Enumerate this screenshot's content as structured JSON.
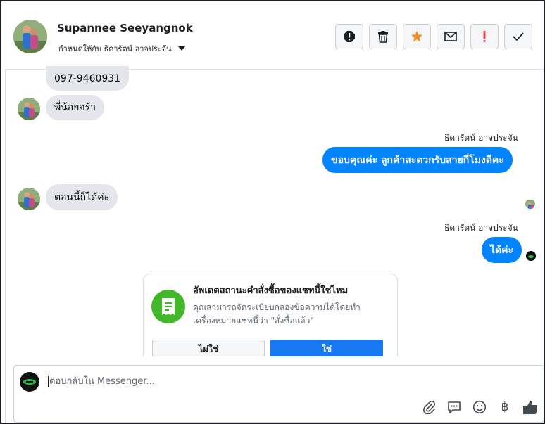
{
  "contact": {
    "name": "Supannee Seeyangnok",
    "assigned_label": "กำหนดให้กับ ธิดารัตน์ อาจประจัน"
  },
  "actions": [
    {
      "name": "spam-icon",
      "color": "#1c1e21"
    },
    {
      "name": "trash-icon",
      "color": "#1c1e21"
    },
    {
      "name": "star-icon",
      "color": "#f28c28"
    },
    {
      "name": "envelope-icon",
      "color": "#1c1e21"
    },
    {
      "name": "exclamation-icon",
      "color": "#fa383e"
    },
    {
      "name": "checkmark-icon",
      "color": "#1c1e21"
    }
  ],
  "messages": [
    {
      "from": "contact",
      "text": "097-9460931"
    },
    {
      "from": "contact",
      "text": "พี่น้อยจร้า"
    },
    {
      "from": "agent",
      "sender": "ธิดารัตน์ อาจประจัน",
      "text": "ขอบคุณค่ะ ลูกค้าสะดวกรับสายกี่โมงดีคะ"
    },
    {
      "from": "contact",
      "text": "ตอนนี้ก็ได้ค่ะ"
    },
    {
      "from": "agent",
      "sender": "ธิดารัตน์ อาจประจัน",
      "text": "ได้ค่ะ"
    }
  ],
  "order_card": {
    "title": "อัพเดตสถานะคำสั่งซื้อของแชทนี้ใช่ไหม",
    "description": "คุณสามารถจัดระเบียบกล่องข้อความได้โดยทำเครื่องหมายแชทนี้ว่า \"สั่งซื้อแล้ว\"",
    "no_label": "ไม่ใช่",
    "yes_label": "ใช่",
    "icon": "receipt-icon"
  },
  "composer": {
    "placeholder": "ตอบกลับใน Messenger...",
    "tools": [
      "paperclip-icon",
      "saved-reply-icon",
      "emoji-icon",
      "baht-icon",
      "thumbs-up-icon"
    ],
    "baht_symbol": "฿"
  },
  "colors": {
    "outgoing_bubble": "#0084ff",
    "incoming_bubble": "#e4e6eb",
    "card_icon": "#42b72a",
    "yes_button": "#1877f2"
  }
}
